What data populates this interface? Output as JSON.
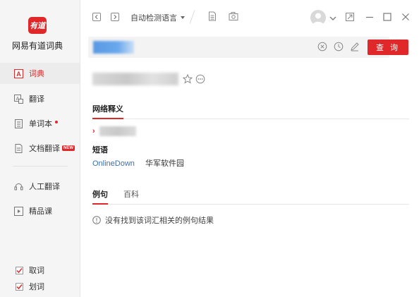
{
  "app": {
    "logo_text": "有道",
    "name": "网易有道词典",
    "accent_color": "#e0282a"
  },
  "sidebar": {
    "items": [
      {
        "label": "词典",
        "icon": "dictionary-icon",
        "active": true
      },
      {
        "label": "翻译",
        "icon": "translate-icon",
        "active": false
      },
      {
        "label": "单词本",
        "icon": "wordbook-icon",
        "active": false,
        "dot": true
      },
      {
        "label": "文档翻译",
        "icon": "document-translate-icon",
        "active": false,
        "badge": "NEW"
      },
      {
        "label": "人工翻译",
        "icon": "human-translate-icon",
        "active": false
      },
      {
        "label": "精品课",
        "icon": "course-icon",
        "active": false
      }
    ],
    "checks": [
      {
        "label": "取词",
        "checked": true
      },
      {
        "label": "划词",
        "checked": true
      }
    ]
  },
  "titlebar": {
    "language_select": "自动检测语言"
  },
  "search": {
    "placeholder": "",
    "query_button": "查 询"
  },
  "result": {
    "tabs_top": [
      {
        "label": "网络释义",
        "active": true
      }
    ],
    "phrase_heading": "短语",
    "phrase_en": "OnlineDown",
    "phrase_cn": "华军软件园",
    "tabs_bottom": [
      {
        "label": "例句",
        "active": true
      },
      {
        "label": "百科",
        "active": false
      }
    ],
    "notice": "没有找到该词汇相关的例句结果"
  }
}
